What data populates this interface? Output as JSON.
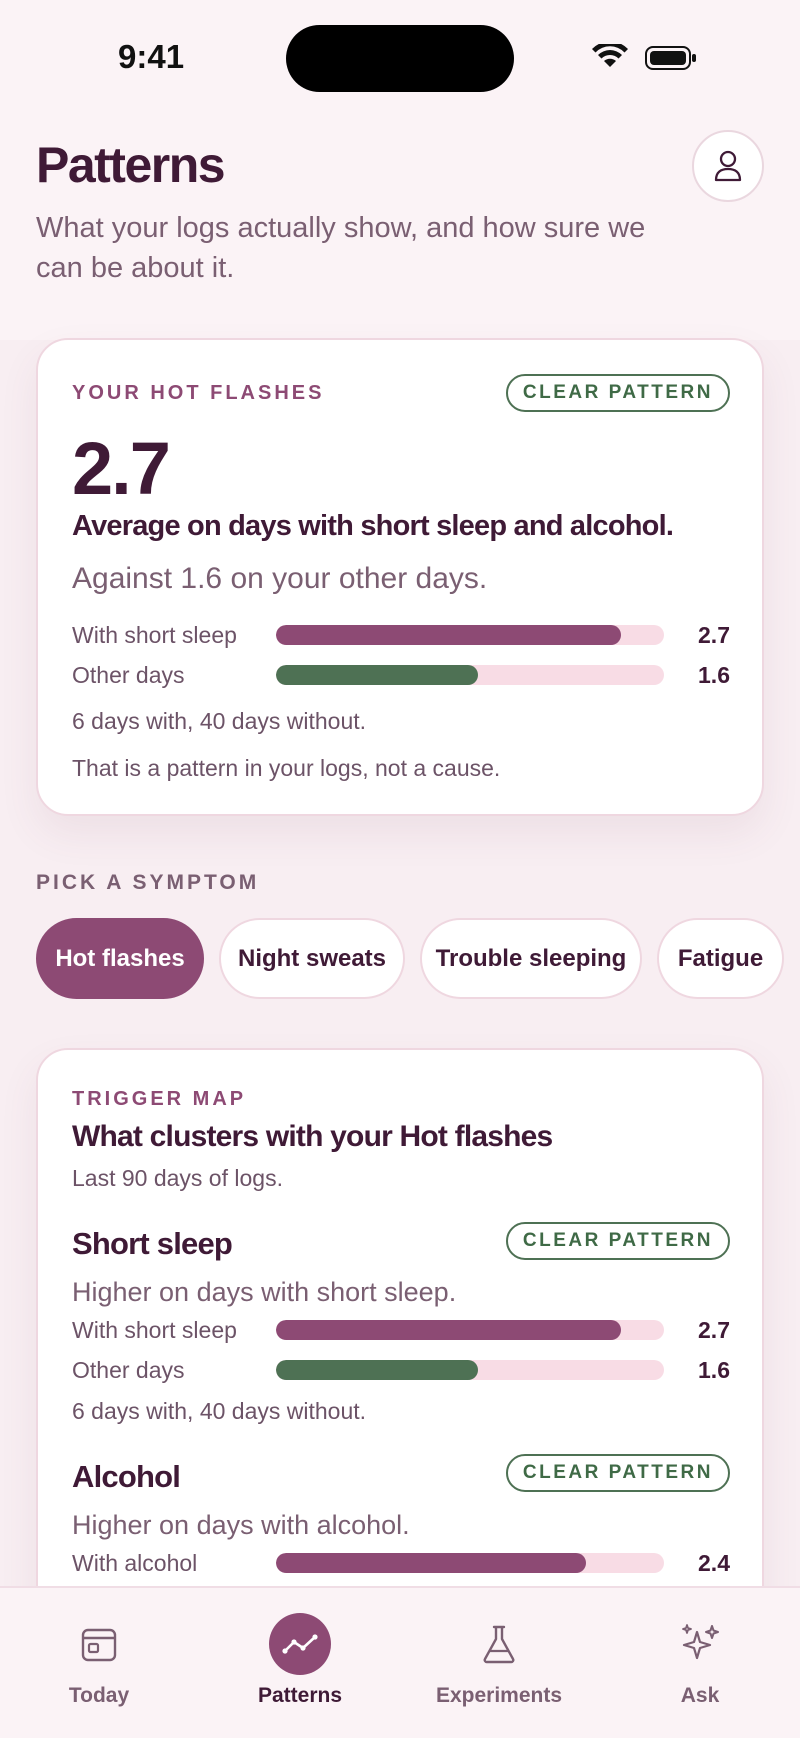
{
  "status_bar": {
    "time": "9:41"
  },
  "header": {
    "title": "Patterns",
    "subtitle": "What your logs actually show, and how sure we can be about it."
  },
  "hot_flashes_card": {
    "eyebrow": "YOUR HOT FLASHES",
    "badge": "CLEAR PATTERN",
    "value": "2.7",
    "headline": "Average on days with short sleep and alcohol.",
    "comparison": "Against 1.6 on your other days.",
    "bars": [
      {
        "label": "With short sleep",
        "value_text": "2.7",
        "fill": 0.89
      },
      {
        "label": "Other days",
        "value_text": "1.6",
        "fill": 0.52
      }
    ],
    "sample_note": "6 days with, 40 days without.",
    "caveat": "That is a pattern in your logs, not a cause."
  },
  "symptom_picker": {
    "label": "PICK A SYMPTOM",
    "chips": [
      "Hot flashes",
      "Night sweats",
      "Trouble sleeping",
      "Fatigue"
    ],
    "selected": "Hot flashes"
  },
  "trigger_map": {
    "eyebrow": "TRIGGER MAP",
    "title": "What clusters with your Hot flashes",
    "subtitle": "Last 90 days of logs.",
    "factors": [
      {
        "title": "Short sleep",
        "badge": "CLEAR PATTERN",
        "subtitle": "Higher on days with short sleep.",
        "bars": [
          {
            "label": "With short sleep",
            "value_text": "2.7",
            "fill": 0.89
          },
          {
            "label": "Other days",
            "value_text": "1.6",
            "fill": 0.52
          }
        ],
        "sample_note": "6 days with, 40 days without."
      },
      {
        "title": "Alcohol",
        "badge": "CLEAR PATTERN",
        "subtitle": "Higher on days with alcohol.",
        "bars": [
          {
            "label": "With alcohol",
            "value_text": "2.4",
            "fill": 0.8
          }
        ]
      }
    ]
  },
  "tab_bar": {
    "tabs": [
      {
        "label": "Today",
        "icon": "calendar-icon"
      },
      {
        "label": "Patterns",
        "icon": "trend-icon"
      },
      {
        "label": "Experiments",
        "icon": "flask-icon"
      },
      {
        "label": "Ask",
        "icon": "sparkles-icon"
      }
    ],
    "active": "Patterns"
  },
  "colors": {
    "plum": "#8d4a74",
    "green": "#4e7154",
    "pink_track": "#f8dce5",
    "text_dark": "#3f1a36"
  }
}
